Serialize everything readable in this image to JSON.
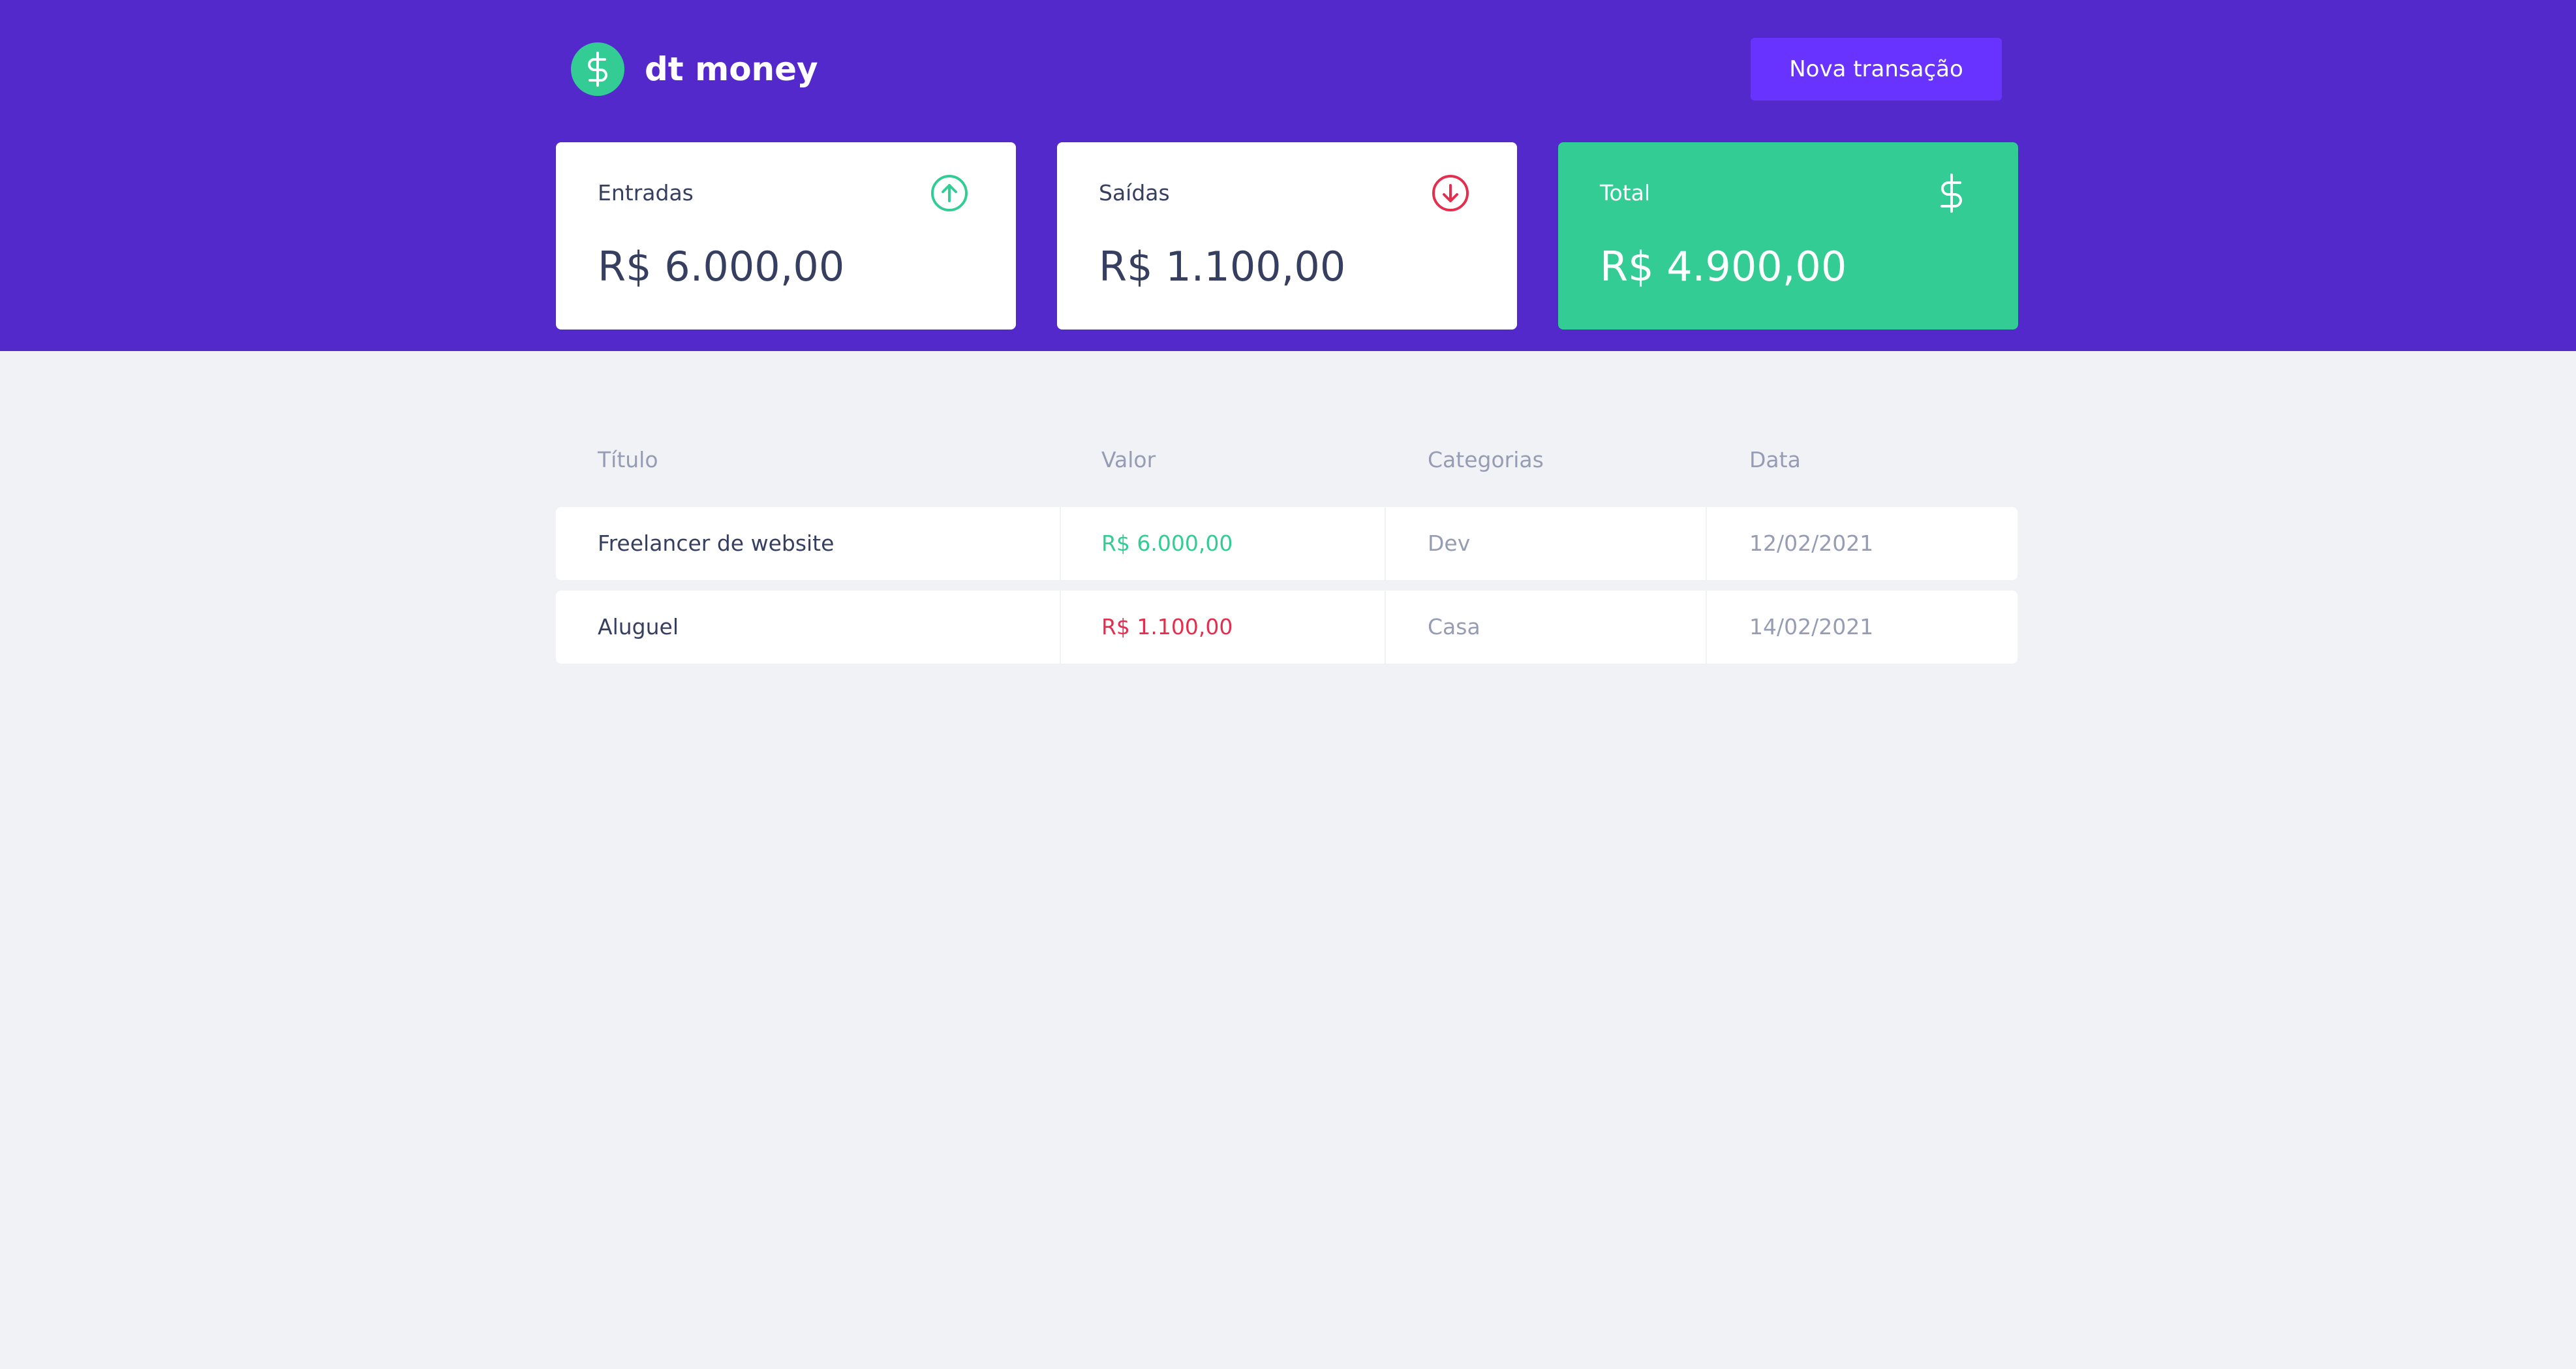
{
  "brand": {
    "name": "dt money",
    "icon": "dollar-sign-icon"
  },
  "header": {
    "new_transaction_label": "Nova transação"
  },
  "summary": {
    "income": {
      "label": "Entradas",
      "value": "R$ 6.000,00",
      "icon": "arrow-up-circle-icon"
    },
    "outcome": {
      "label": "Saídas",
      "value": "R$ 1.100,00",
      "icon": "arrow-down-circle-icon"
    },
    "total": {
      "label": "Total",
      "value": "R$ 4.900,00",
      "icon": "dollar-sign-icon"
    }
  },
  "table": {
    "headers": [
      "Título",
      "Valor",
      "Categorias",
      "Data"
    ],
    "rows": [
      {
        "title": "Freelancer de website",
        "amount": "R$ 6.000,00",
        "type": "income",
        "category": "Dev",
        "date": "12/02/2021"
      },
      {
        "title": "Aluguel",
        "amount": "R$ 1.100,00",
        "type": "outcome",
        "category": "Casa",
        "date": "14/02/2021"
      }
    ]
  },
  "colors": {
    "header_bg": "#5429CC",
    "button_bg": "#6933FF",
    "green": "#33CC95",
    "red": "#E52E4D",
    "background": "#F0F2F5",
    "text_title": "#363F5F",
    "text_body": "#969CB3"
  }
}
